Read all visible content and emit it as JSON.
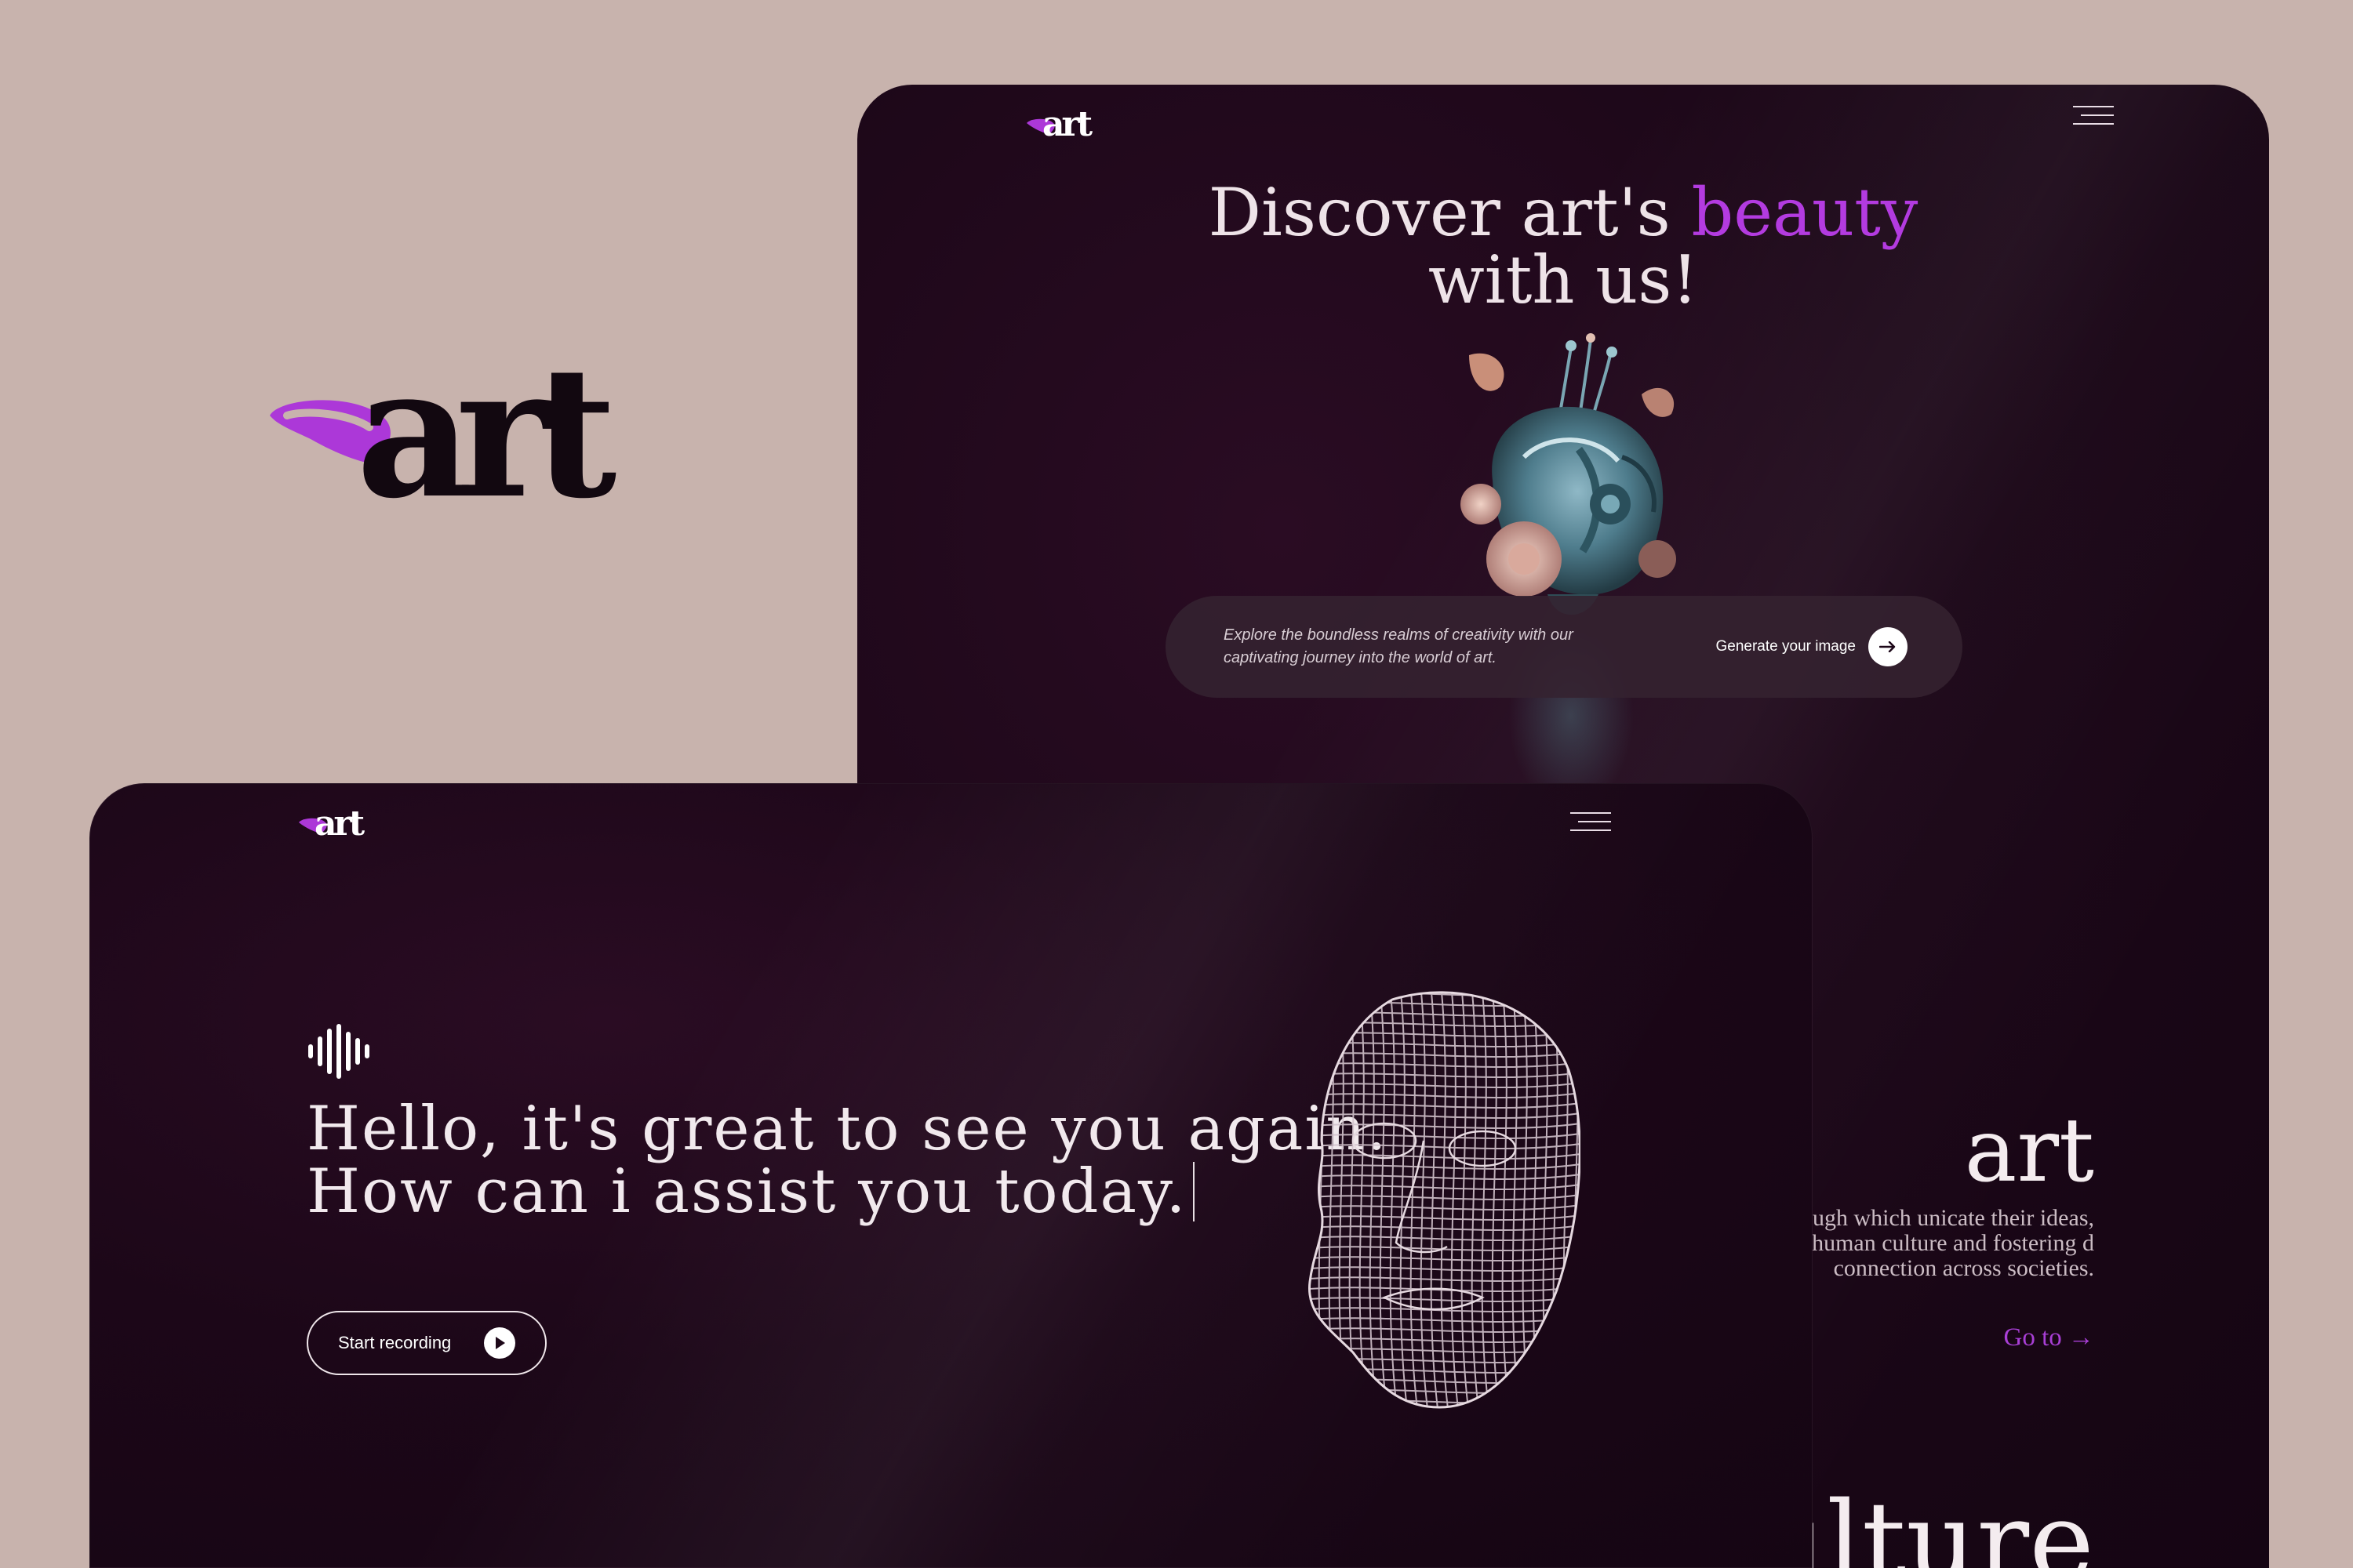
{
  "brand": {
    "logo_text": "art",
    "accent_color": "#b33be0"
  },
  "back_screen": {
    "hero": {
      "title_part1": "Discover art's",
      "title_accent": "beauty",
      "title_part2": "with us!"
    },
    "cta": {
      "description": "Explore the boundless realms of creativity with our captivating journey into the world of art.",
      "button_label": "Generate your image",
      "button_icon": "arrow-right-icon"
    },
    "art_section": {
      "title": "art",
      "text": "ssive medium through which unicate their ideas, emotions, human culture and fostering d connection across societies.",
      "link": "Go to →"
    },
    "culture_section": {
      "title": "ulture"
    }
  },
  "front_screen": {
    "greeting_line1": "Hello, it's great to see you again.",
    "greeting_line2": "How can i assist you today.",
    "record_button": {
      "label": "Start recording",
      "icon": "play-icon"
    }
  },
  "colors": {
    "background": "#c8b3ad",
    "screen_bg": "#1c0718",
    "accent": "#b33be0"
  }
}
